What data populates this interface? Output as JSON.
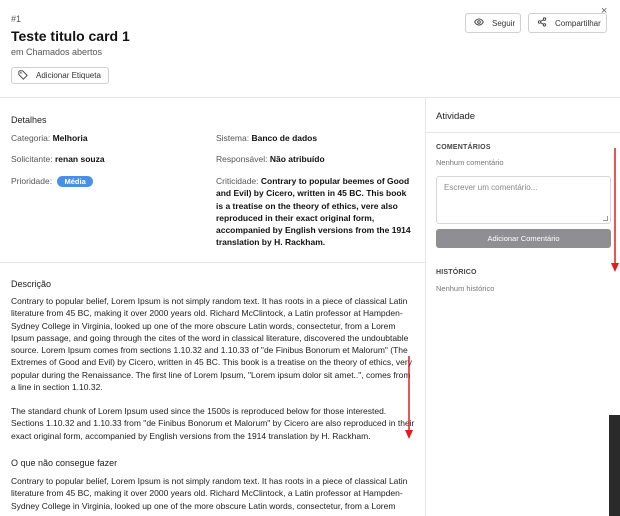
{
  "header": {
    "card_id": "#1",
    "title": "Teste titulo card 1",
    "subtitle": "em Chamados abertos",
    "tag_button": "Adicionar Etiqueta",
    "follow_button": "Seguir",
    "share_button": "Compartilhar",
    "close": "×"
  },
  "details": {
    "title": "Detalhes",
    "categoria_label": "Categoria:",
    "categoria_value": "Melhoria",
    "sistema_label": "Sistema:",
    "sistema_value": "Banco de dados",
    "solicitante_label": "Solicitante:",
    "solicitante_value": "renan souza",
    "responsavel_label": "Responsável:",
    "responsavel_value": "Não atribuído",
    "prioridade_label": "Prioridade:",
    "prioridade_value": "Média",
    "criticidade_label": "Criticidade:",
    "criticidade_value": "Contrary to popular beemes of Good and Evil) by Cicero, written in 45 BC. This book is a treatise on the theory of ethics, vere also reproduced in their exact original form, accompanied by English versions from the 1914 translation by H. Rackham."
  },
  "description": {
    "title": "Descrição",
    "p1": "Contrary to popular belief, Lorem Ipsum is not simply random text. It has roots in a piece of classical Latin literature from 45 BC, making it over 2000 years old. Richard McClintock, a Latin professor at Hampden-Sydney College in Virginia, looked up one of the more obscure Latin words, consectetur, from a Lorem Ipsum passage, and going through the cites of the word in classical literature, discovered the undoubtable source. Lorem Ipsum comes from sections 1.10.32 and 1.10.33 of \"de Finibus Bonorum et Malorum\" (The Extremes of Good and Evil) by Cicero, written in 45 BC. This book is a treatise on the theory of ethics, very popular during the Renaissance. The first line of Lorem Ipsum, \"Lorem ipsum dolor sit amet..\", comes from a line in section 1.10.32.",
    "p2": "The standard chunk of Lorem Ipsum used since the 1500s is reproduced below for those interested. Sections 1.10.32 and 1.10.33 from \"de Finibus Bonorum et Malorum\" by Cicero are also reproduced in their exact original form, accompanied by English versions from the 1914 translation by H. Rackham."
  },
  "cannot_do": {
    "title": "O que não consegue fazer",
    "p1": "Contrary to popular belief, Lorem Ipsum is not simply random text. It has roots in a piece of classical Latin literature from 45 BC, making it over 2000 years old. Richard McClintock, a Latin professor at Hampden-Sydney College in Virginia, looked up one of the more obscure Latin words, consectetur, from a Lorem"
  },
  "activity": {
    "title": "Atividade",
    "comments_label": "COMENTÁRIOS",
    "no_comments": "Nenhum comentário",
    "comment_placeholder": "Escrever um comentário...",
    "add_comment_button": "Adicionar Comentário",
    "history_label": "HISTÓRICO",
    "no_history": "Nenhum histórico"
  },
  "colors": {
    "badge": "#4a8fe7",
    "button_gray": "#8f8f93",
    "arrow": "#e11d1d"
  }
}
